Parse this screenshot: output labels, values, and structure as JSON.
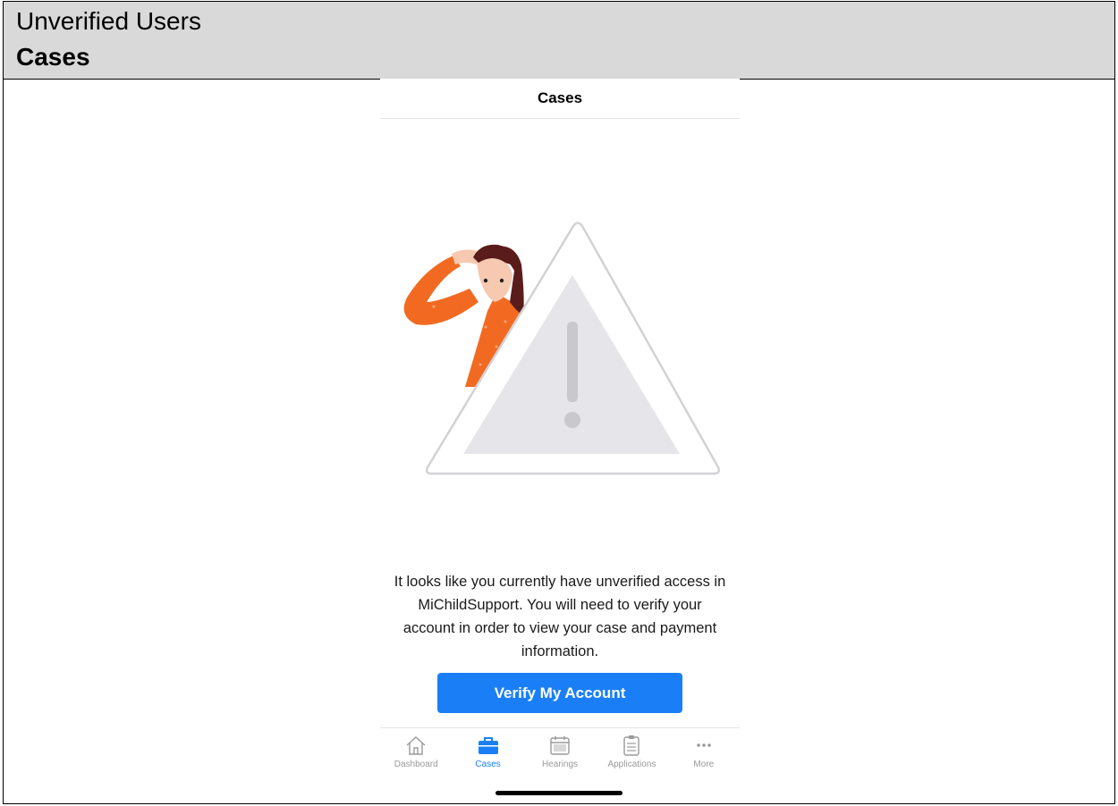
{
  "doc_header": {
    "subtitle": "Unverified Users",
    "title": "Cases"
  },
  "screen": {
    "nav_title": "Cases",
    "message": "It looks like you currently have unverified access in MiChildSupport.  You will need to verify your account in order to view your case and payment information.",
    "verify_button": "Verify My Account"
  },
  "tabbar": {
    "tabs": [
      {
        "label": "Dashboard",
        "icon": "house-icon",
        "active": false
      },
      {
        "label": "Cases",
        "icon": "briefcase-icon",
        "active": true
      },
      {
        "label": "Hearings",
        "icon": "calendar-icon",
        "active": false
      },
      {
        "label": "Applications",
        "icon": "clipboard-icon",
        "active": false
      },
      {
        "label": "More",
        "icon": "ellipsis-icon",
        "active": false
      }
    ]
  },
  "colors": {
    "accent": "#1a7ff7",
    "header_bg": "#d9d9d9",
    "inactive_tab": "#9a9a9a"
  }
}
